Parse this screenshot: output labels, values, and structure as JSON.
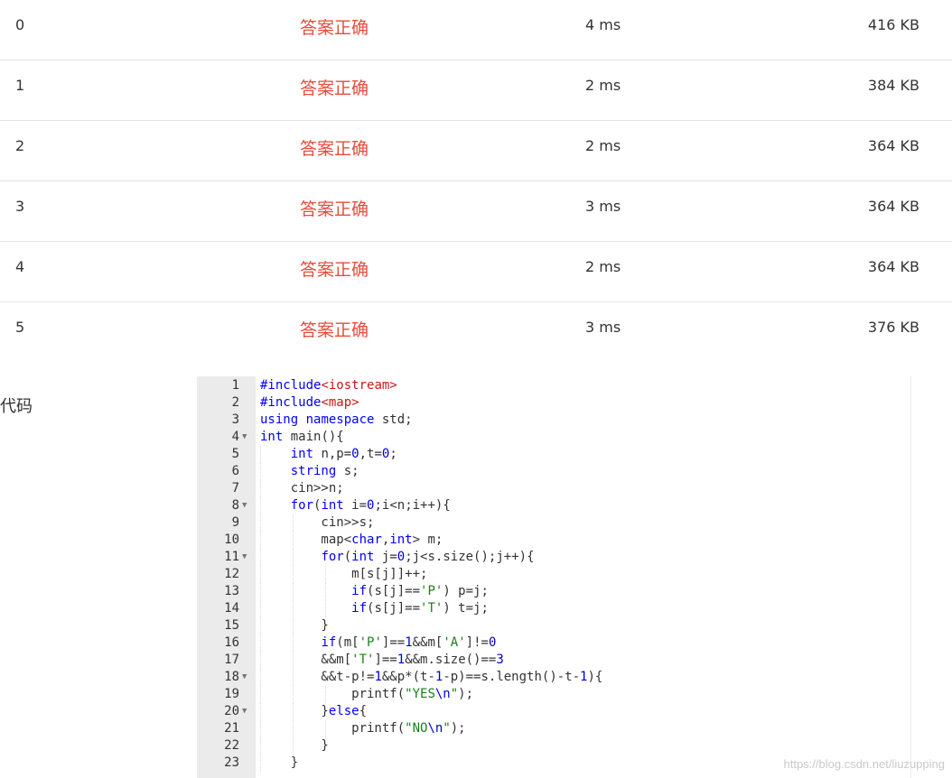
{
  "results": [
    {
      "id": "0",
      "status": "答案正确",
      "time": "4 ms",
      "memory": "416 KB"
    },
    {
      "id": "1",
      "status": "答案正确",
      "time": "2 ms",
      "memory": "384 KB"
    },
    {
      "id": "2",
      "status": "答案正确",
      "time": "2 ms",
      "memory": "364 KB"
    },
    {
      "id": "3",
      "status": "答案正确",
      "time": "3 ms",
      "memory": "364 KB"
    },
    {
      "id": "4",
      "status": "答案正确",
      "time": "2 ms",
      "memory": "364 KB"
    },
    {
      "id": "5",
      "status": "答案正确",
      "time": "3 ms",
      "memory": "376 KB"
    }
  ],
  "code_section": {
    "label": "代码",
    "lines": [
      {
        "n": "1",
        "text": "#include<iostream>"
      },
      {
        "n": "2",
        "text": "#include<map>"
      },
      {
        "n": "3",
        "text": "using namespace std;"
      },
      {
        "n": "4",
        "text": "int main(){",
        "fold": true
      },
      {
        "n": "5",
        "text": "    int n,p=0,t=0;"
      },
      {
        "n": "6",
        "text": "    string s;"
      },
      {
        "n": "7",
        "text": "    cin>>n;"
      },
      {
        "n": "8",
        "text": "    for(int i=0;i<n;i++){",
        "fold": true
      },
      {
        "n": "9",
        "text": "        cin>>s;"
      },
      {
        "n": "10",
        "text": "        map<char,int> m;"
      },
      {
        "n": "11",
        "text": "        for(int j=0;j<s.size();j++){",
        "fold": true
      },
      {
        "n": "12",
        "text": "            m[s[j]]++;"
      },
      {
        "n": "13",
        "text": "            if(s[j]=='P') p=j;"
      },
      {
        "n": "14",
        "text": "            if(s[j]=='T') t=j;"
      },
      {
        "n": "15",
        "text": "        }"
      },
      {
        "n": "16",
        "text": "        if(m['P']==1&&m['A']!=0"
      },
      {
        "n": "17",
        "text": "        &&m['T']==1&&m.size()==3"
      },
      {
        "n": "18",
        "text": "        &&t-p!=1&&p*(t-1-p)==s.length()-t-1){",
        "fold": true
      },
      {
        "n": "19",
        "text": "            printf(\"YES\\n\");"
      },
      {
        "n": "20",
        "text": "        }else{",
        "fold": true
      },
      {
        "n": "21",
        "text": "            printf(\"NO\\n\");"
      },
      {
        "n": "22",
        "text": "        }"
      },
      {
        "n": "23",
        "text": "    }"
      }
    ]
  },
  "watermark": "https://blog.csdn.net/liuzupping",
  "colors": {
    "status_ok": "#e74c3c",
    "keyword": "#0000ff",
    "string": "#1a7f1a",
    "number": "#0000cd"
  }
}
